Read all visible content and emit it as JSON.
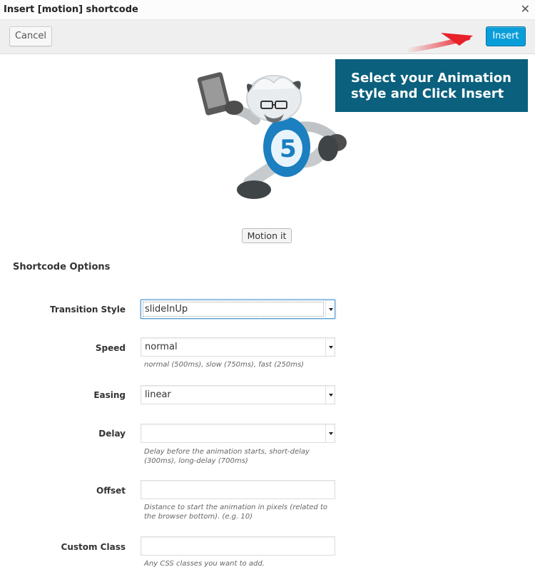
{
  "window": {
    "title": "Insert [motion] shortcode",
    "close_icon": "close-icon"
  },
  "toolbar": {
    "cancel_label": "Cancel",
    "insert_label": "Insert"
  },
  "callout": {
    "line1": "Select your Animation",
    "line2": "style and Click Insert"
  },
  "preview": {
    "motion_button": "Motion it"
  },
  "options": {
    "heading": "Shortcode Options",
    "fields": [
      {
        "label": "Transition Style",
        "value": "slideInUp",
        "type": "select",
        "hint": ""
      },
      {
        "label": "Speed",
        "value": "normal",
        "type": "select",
        "hint": "normal (500ms), slow (750ms), fast (250ms)"
      },
      {
        "label": "Easing",
        "value": "linear",
        "type": "select",
        "hint": ""
      },
      {
        "label": "Delay",
        "value": "",
        "type": "select",
        "hint": "Delay before the animation starts, short-delay (300ms), long-delay (700ms)"
      },
      {
        "label": "Offset",
        "value": "",
        "type": "text",
        "hint": "Distance to start the animation in pixels (related to the browser bottom). (e.g. 10)"
      },
      {
        "label": "Custom Class",
        "value": "",
        "type": "text",
        "hint": "Any CSS classes you want to add."
      }
    ]
  },
  "colors": {
    "insert_button": "#0a9ed9",
    "callout_bg": "#0a607d",
    "arrow": "#e8202a",
    "mascot_shirt": "#1b7fc0"
  }
}
